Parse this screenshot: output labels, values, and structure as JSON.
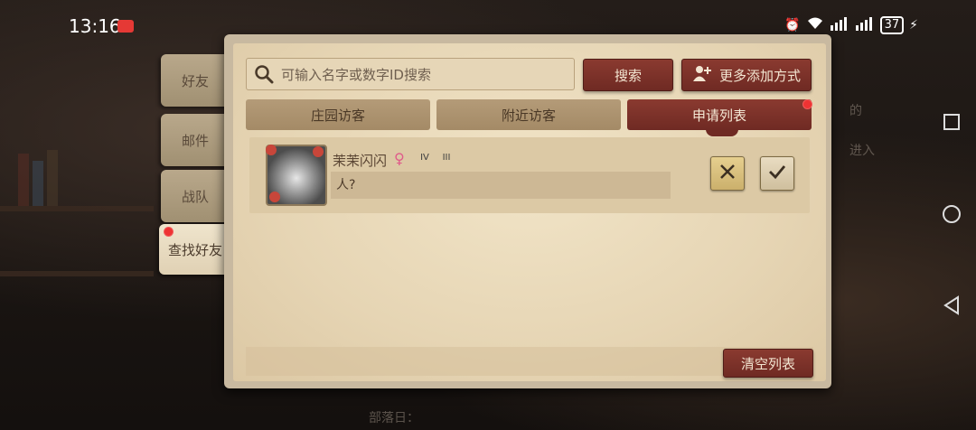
{
  "status_bar": {
    "time": "13:16",
    "battery": "37"
  },
  "side_tabs": [
    {
      "label": "好友"
    },
    {
      "label": "邮件"
    },
    {
      "label": "战队"
    },
    {
      "label": "查找好友"
    }
  ],
  "search": {
    "placeholder": "可输入名字或数字ID搜索",
    "value": ""
  },
  "buttons": {
    "search": "搜索",
    "more_add": "更多添加方式",
    "clear_list": "清空列表"
  },
  "tabs": [
    {
      "label": "庄园访客"
    },
    {
      "label": "附近访客"
    },
    {
      "label": "申请列表"
    }
  ],
  "requests": [
    {
      "name": "茉茉闪闪",
      "gender_symbol": "♀",
      "badge1": "IV",
      "badge2": "III",
      "message": "人?"
    }
  ],
  "background": {
    "fragment_1": "的",
    "fragment_2": "进入",
    "fragment_3": "部落日："
  },
  "colors": {
    "accent_red": "#7a2f27",
    "parchment": "#ead9b9",
    "notify_dot": "#e33333"
  }
}
